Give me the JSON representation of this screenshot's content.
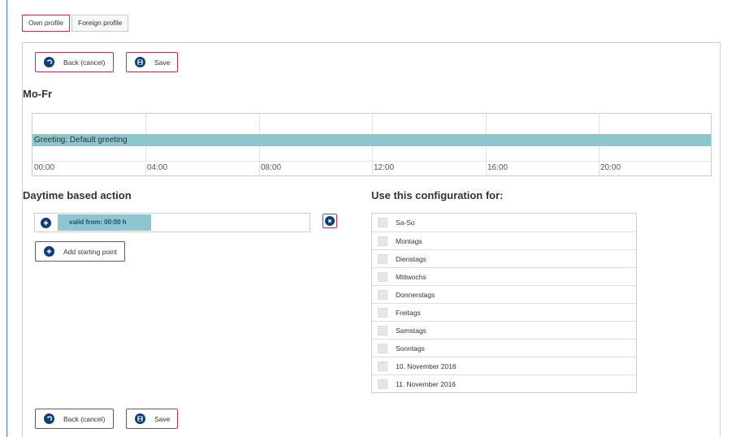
{
  "tabs": [
    {
      "label": "Own profile",
      "active": true
    },
    {
      "label": "Foreign profile",
      "active": false
    }
  ],
  "toolbar": {
    "back_label": "Back (cancel)",
    "save_label": "Save"
  },
  "schedule": {
    "title": "Mo-Fr",
    "greeting_bar": "Greeting: Default greeting",
    "ticks": [
      "00:00",
      "04:00",
      "08:00",
      "12:00",
      "16:00",
      "20:00"
    ]
  },
  "daytime": {
    "title": "Daytime based action",
    "valid_from": "valid from: 00:00 h",
    "add_label": "Add starting point"
  },
  "config": {
    "title": "Use this configuration for:",
    "items": [
      "Sa-So",
      "Montags",
      "Dienstags",
      "Mittwochs",
      "Donnerstags",
      "Freitags",
      "Samstags",
      "Sonntags",
      "10. November 2016",
      "11. November 2016"
    ]
  },
  "colors": {
    "accent_border": "#b5334d",
    "icon_blue": "#0a3f7e",
    "bar_teal": "#8cc7cf"
  }
}
